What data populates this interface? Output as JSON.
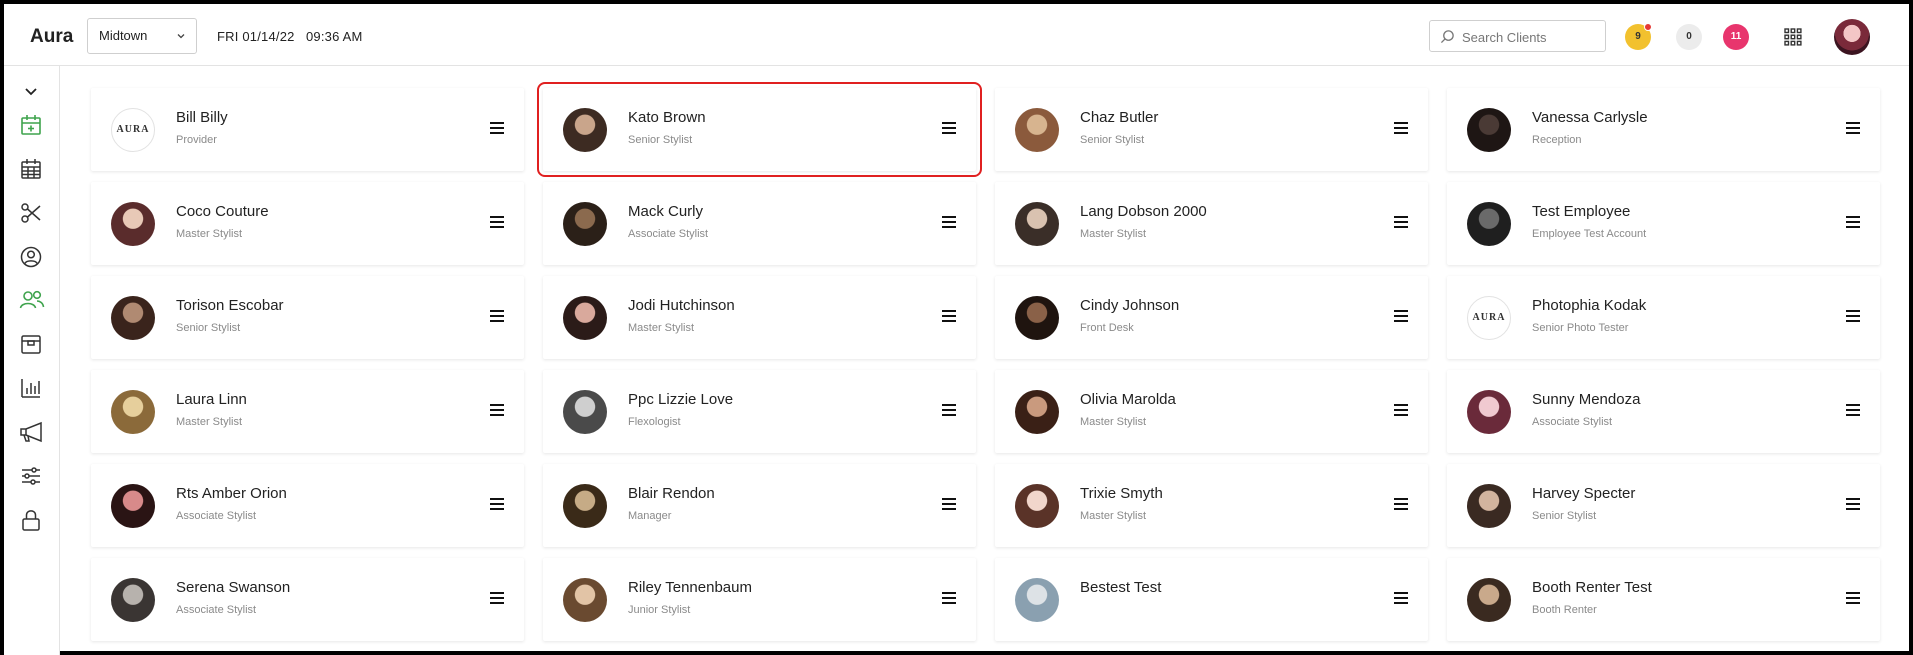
{
  "header": {
    "brand": "Aura",
    "location": "Midtown",
    "datetime": "FRI 01/14/22   09:36 AM",
    "search_placeholder": "Search Clients",
    "badges": {
      "yellow": "9",
      "grey": "0",
      "pink": "11"
    }
  },
  "sidebar": {
    "items": [
      {
        "icon": "chevron-down-icon"
      },
      {
        "icon": "calendar-add-icon"
      },
      {
        "icon": "calendar-icon"
      },
      {
        "icon": "scissors-icon"
      },
      {
        "icon": "user-circle-icon"
      },
      {
        "icon": "users-icon"
      },
      {
        "icon": "box-icon"
      },
      {
        "icon": "bar-chart-icon"
      },
      {
        "icon": "megaphone-icon"
      },
      {
        "icon": "sliders-icon"
      },
      {
        "icon": "lock-icon"
      }
    ]
  },
  "logo_text": "AURA",
  "employees": [
    {
      "name": "Bill Billy",
      "role": "Provider",
      "logo": true
    },
    {
      "name": "Kato Brown",
      "role": "Senior Stylist",
      "selected": true
    },
    {
      "name": "Chaz Butler",
      "role": "Senior Stylist"
    },
    {
      "name": "Vanessa Carlysle",
      "role": "Reception"
    },
    {
      "name": "Coco Couture",
      "role": "Master Stylist"
    },
    {
      "name": "Mack Curly",
      "role": "Associate Stylist"
    },
    {
      "name": "Lang Dobson 2000",
      "role": "Master Stylist"
    },
    {
      "name": "Test Employee",
      "role": "Employee Test Account"
    },
    {
      "name": "Torison Escobar",
      "role": "Senior Stylist"
    },
    {
      "name": "Jodi Hutchinson",
      "role": "Master Stylist"
    },
    {
      "name": "Cindy Johnson",
      "role": "Front Desk"
    },
    {
      "name": "Photophia Kodak",
      "role": "Senior Photo Tester",
      "logo": true
    },
    {
      "name": "Laura Linn",
      "role": "Master Stylist"
    },
    {
      "name": "Ppc Lizzie Love",
      "role": "Flexologist"
    },
    {
      "name": "Olivia Marolda",
      "role": "Master Stylist"
    },
    {
      "name": "Sunny Mendoza",
      "role": "Associate Stylist"
    },
    {
      "name": "Rts Amber Orion",
      "role": "Associate Stylist"
    },
    {
      "name": "Blair Rendon",
      "role": "Manager"
    },
    {
      "name": "Trixie Smyth",
      "role": "Master Stylist"
    },
    {
      "name": "Harvey Specter",
      "role": "Senior Stylist"
    },
    {
      "name": "Serena Swanson",
      "role": "Associate Stylist"
    },
    {
      "name": "Riley Tennenbaum",
      "role": "Junior Stylist"
    },
    {
      "name": "Bestest Test",
      "role": ""
    },
    {
      "name": "Booth Renter Test",
      "role": "Booth Renter"
    }
  ],
  "colors": {
    "accent_green": "#3fa34d",
    "selected_outline": "#e02020",
    "badge_yellow": "#f2c12e",
    "badge_pink": "#e8356d"
  }
}
